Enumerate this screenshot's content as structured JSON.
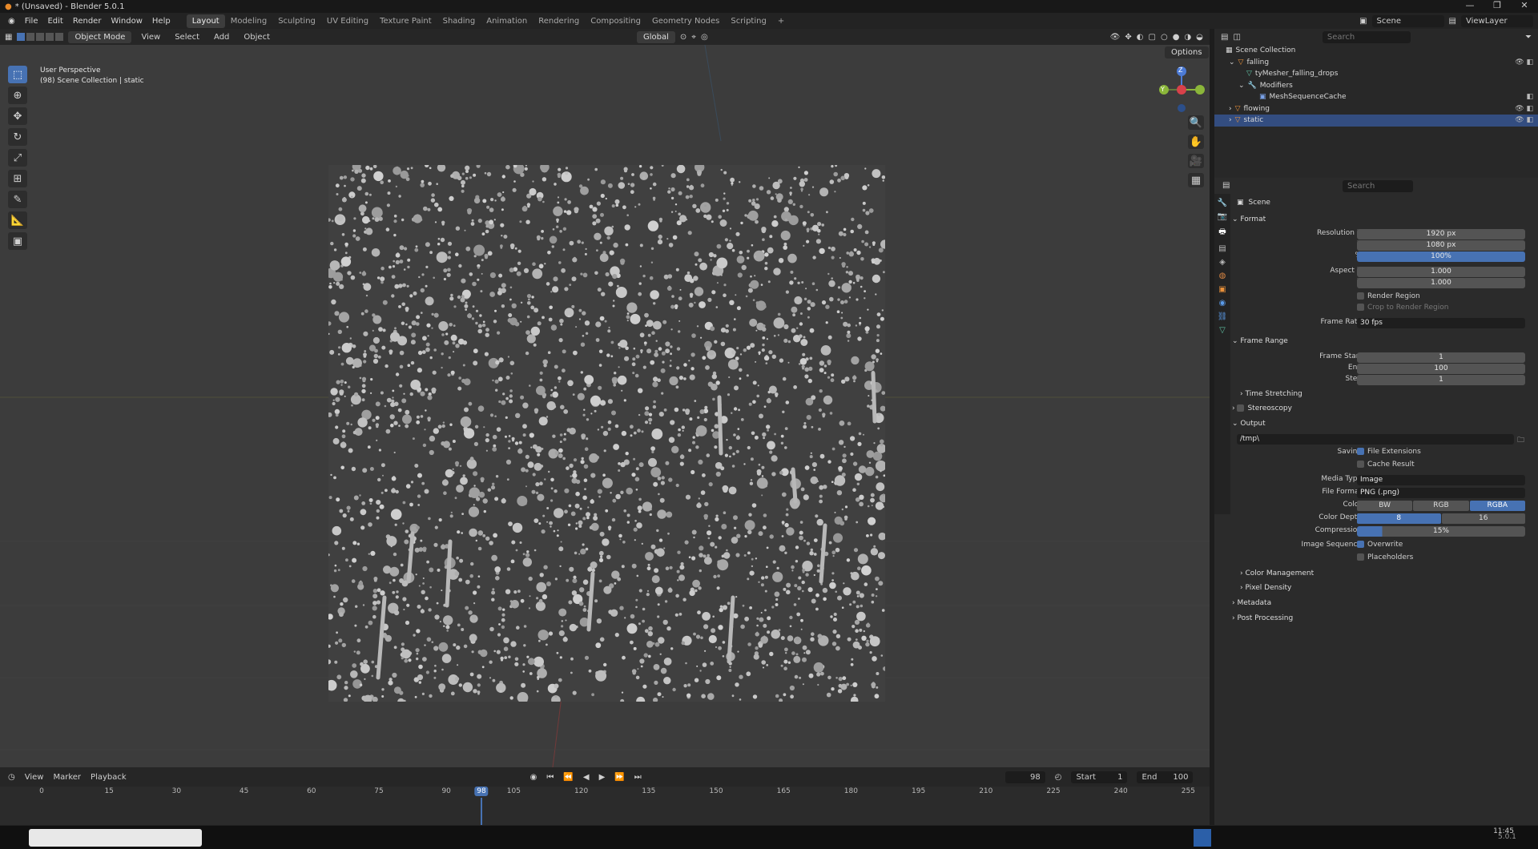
{
  "window": {
    "title": "* (Unsaved) - Blender 5.0.1"
  },
  "menu": {
    "items": [
      "File",
      "Edit",
      "Render",
      "Window",
      "Help"
    ]
  },
  "workspaces": [
    "Layout",
    "Modeling",
    "Sculpting",
    "UV Editing",
    "Texture Paint",
    "Shading",
    "Animation",
    "Rendering",
    "Compositing",
    "Geometry Nodes",
    "Scripting",
    "+"
  ],
  "topright": {
    "scene": "Scene",
    "view_layer": "ViewLayer"
  },
  "viewport": {
    "mode": "Object Mode",
    "menu": [
      "View",
      "Select",
      "Add",
      "Object"
    ],
    "orientation": "Global",
    "options": "Options",
    "info_line1": "User Perspective",
    "info_line2": "(98) Scene Collection | static",
    "gizmo_z": "Z",
    "gizmo_y": "Y"
  },
  "timeline": {
    "menu": [
      "View",
      "Marker",
      "Playback"
    ],
    "current_frame": "98",
    "start_label": "Start",
    "start": "1",
    "end_label": "End",
    "end": "100",
    "ticks": [
      "0",
      "15",
      "30",
      "45",
      "60",
      "75",
      "90",
      "105",
      "120",
      "135",
      "150",
      "165",
      "180",
      "195",
      "210",
      "225",
      "240",
      "255"
    ]
  },
  "outliner": {
    "search_placeholder": "Search",
    "rows": [
      "Scene Collection",
      "falling",
      "tyMesher_falling_drops",
      "Modifiers",
      "MeshSequenceCache",
      "flowing",
      "static"
    ]
  },
  "properties": {
    "search_placeholder": "Search",
    "context": "Scene",
    "format": {
      "title": "Format",
      "res_x_label": "Resolution X",
      "res_x": "1920 px",
      "res_y_label": "Y",
      "res_y": "1080 px",
      "pct_label": "%",
      "pct": "100%",
      "aspect_x_label": "Aspect X",
      "aspect_x": "1.000",
      "aspect_y_label": "Y",
      "aspect_y": "1.000",
      "render_region": "Render Region",
      "crop": "Crop to Render Region",
      "frame_rate_label": "Frame Rate",
      "frame_rate": "30 fps"
    },
    "frame_range": {
      "title": "Frame Range",
      "start_label": "Frame Start",
      "start": "1",
      "end_label": "End",
      "end": "100",
      "step_label": "Step",
      "step": "1"
    },
    "time_stretching": "Time Stretching",
    "stereoscopy": "Stereoscopy",
    "output": {
      "title": "Output",
      "path": "/tmp\\",
      "saving_label": "Saving",
      "file_ext": "File Extensions",
      "cache_result": "Cache Result",
      "media_type_label": "Media Type",
      "media_type": "Image",
      "file_format_label": "File Format",
      "file_format": "PNG (.png)",
      "color_label": "Color",
      "color_opts": [
        "BW",
        "RGB",
        "RGBA"
      ],
      "depth_label": "Color Depth",
      "depth_opts": [
        "8",
        "16"
      ],
      "compression_label": "Compression",
      "compression": "15%",
      "image_seq_label": "Image Sequence",
      "overwrite": "Overwrite",
      "placeholders": "Placeholders"
    },
    "color_management": "Color Management",
    "pixel_density": "Pixel Density",
    "metadata": "Metadata",
    "post_processing": "Post Processing"
  },
  "status": {
    "version": "5.0.1",
    "clock": "11:45"
  },
  "colors": {
    "accent": "#4772b3",
    "viewport_bg": "#3c3c3c"
  }
}
